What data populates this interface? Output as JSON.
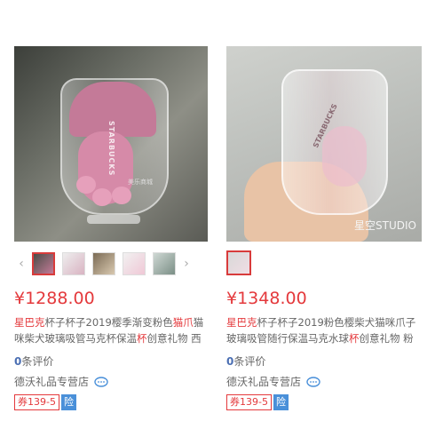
{
  "products": [
    {
      "price": "¥1288.00",
      "title_parts": [
        "星巴克",
        "杯子杯子2019樱季渐变粉色",
        "猫爪",
        "猫咪柴犬玻璃吸管马克杯保温",
        "杯",
        "创意礼物 西"
      ],
      "review_count": "0",
      "review_suffix": "条评价",
      "store": "德沃礼品专营店",
      "coupon": "券139-5",
      "insurance": "险",
      "brand_mark": "STARBUCKS",
      "watermark": "美乐商城"
    },
    {
      "price": "¥1348.00",
      "title_parts": [
        "星巴克",
        "杯子杯子2019粉色樱柴犬猫咪爪子玻璃吸管随行保温马克水球",
        "杯",
        "创意礼物 粉"
      ],
      "review_count": "0",
      "review_suffix": "条评价",
      "store": "德沃礼品专营店",
      "coupon": "券139-5",
      "insurance": "险",
      "brand_mark": "STARBUCKS",
      "watermark": "星空STUDIO"
    }
  ],
  "icons": {
    "prev": "chevron-left-icon",
    "next": "chevron-right-icon",
    "chat": "chat-bubble-icon"
  },
  "colors": {
    "price": "#e4393c",
    "keyword": "#e4393c",
    "review_count": "#4b6fb3",
    "insurance_bg": "#4a90d9"
  }
}
